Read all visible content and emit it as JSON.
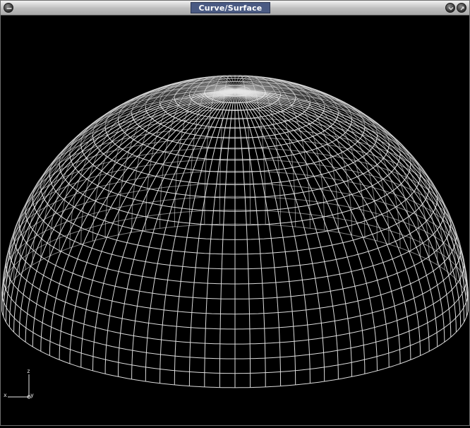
{
  "window": {
    "title": "Curve/Surface"
  },
  "axes": {
    "z_label": "z",
    "x_label": "x",
    "y_label": "y"
  },
  "colors": {
    "wire": "#e6e6e6",
    "background": "#000000",
    "title_bg": "#4a5a82"
  },
  "icons": {
    "menu": "minus-circle-icon",
    "minimize": "chevron-down-icon",
    "maximize": "expand-icon"
  },
  "surface": {
    "kind": "hemisphere",
    "meridians": 96,
    "parallels": 24
  }
}
